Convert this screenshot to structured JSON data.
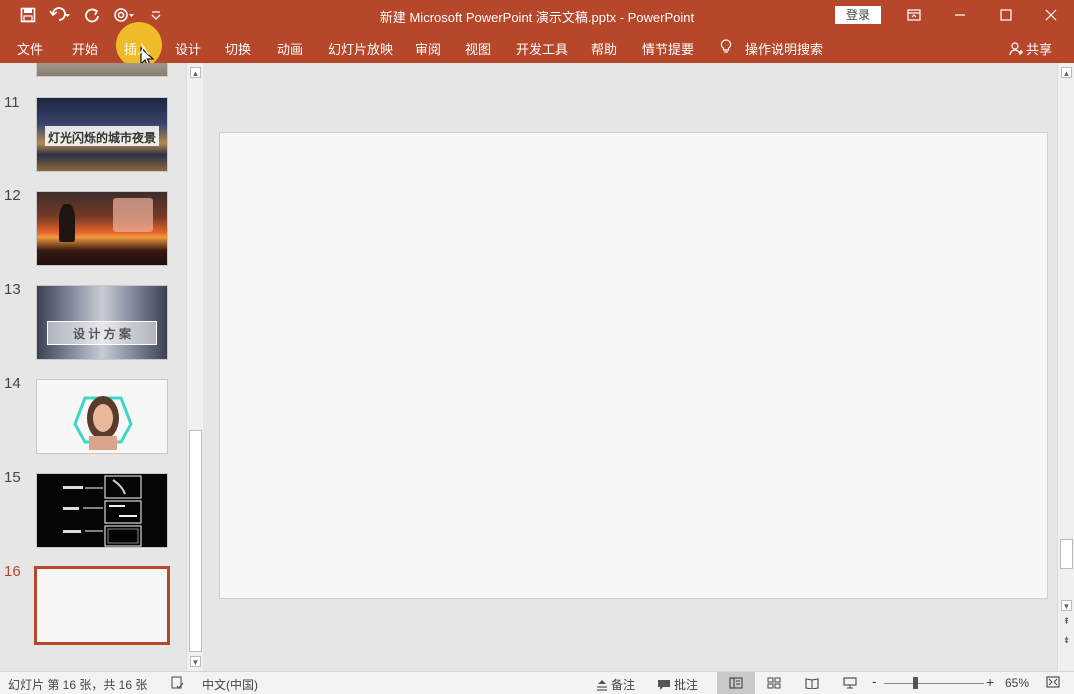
{
  "window": {
    "title": "新建 Microsoft PowerPoint 演示文稿.pptx  -  PowerPoint",
    "login_label": "登录"
  },
  "quick_access": [
    "save-icon",
    "undo-icon",
    "redo-icon",
    "touch-mode-icon",
    "customize-qat-icon"
  ],
  "ribbon": {
    "tabs": [
      "文件",
      "开始",
      "插入",
      "设计",
      "切换",
      "动画",
      "幻灯片放映",
      "审阅",
      "视图",
      "开发工具",
      "帮助",
      "情节提要",
      "操作说明搜索"
    ],
    "share_label": "共享"
  },
  "thumbnails": [
    {
      "number": "11",
      "title": "灯光闪烁的城市夜景"
    },
    {
      "number": "12",
      "title": ""
    },
    {
      "number": "13",
      "title": "设 计 方 案"
    },
    {
      "number": "14",
      "title": ""
    },
    {
      "number": "15",
      "title": ""
    },
    {
      "number": "16",
      "title": ""
    }
  ],
  "status": {
    "slide_info": "幻灯片 第 16 张，共 16 张",
    "language": "中文(中国)",
    "notes_label": "备注",
    "comments_label": "批注",
    "zoom": "65%"
  },
  "colors": {
    "accent": "#b7472a",
    "highlight": "#f5c828"
  }
}
